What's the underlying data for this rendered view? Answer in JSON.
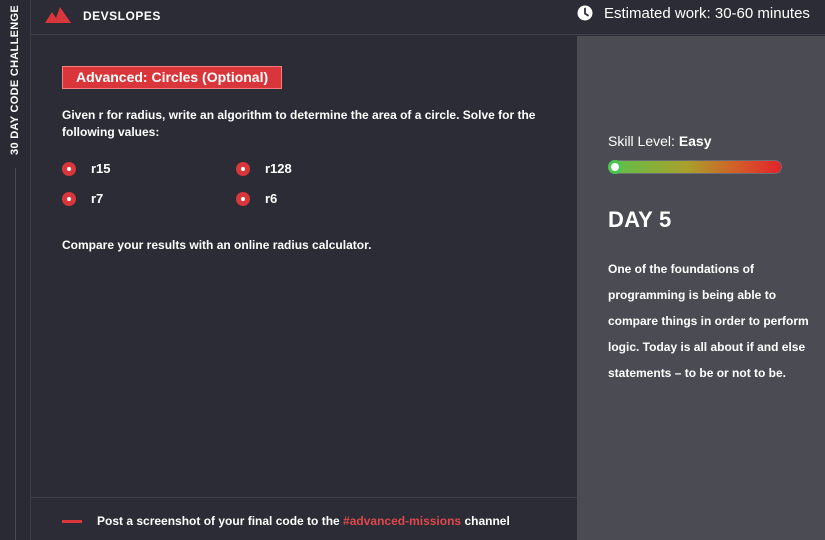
{
  "side_strip": {
    "label": "30 DAY CODE CHALLENGE"
  },
  "header": {
    "brand": "DEVSLOPES",
    "estimate": "Estimated work: 30-60 minutes",
    "icons": {
      "logo": "devslopes-logo-icon",
      "clock": "clock-icon"
    }
  },
  "mission": {
    "badge": "Advanced: Circles (Optional)",
    "description": "Given r for radius, write an algorithm to determine the area of a circle. Solve for the following values:",
    "values": [
      "r15",
      "r128",
      "r7",
      "r6"
    ],
    "compare": "Compare your results with an online radius calculator.",
    "footer": {
      "prefix": "Post a screenshot of your final code to the ",
      "channel": "#advanced-missions",
      "suffix": " channel"
    }
  },
  "sidebar": {
    "skill_label": "Skill Level: ",
    "skill_value": "Easy",
    "skill_level_fraction": 0.0,
    "day": "DAY 5",
    "paragraph": "One of the foundations of programming is being able to compare things in order to perform logic. Today is all about if and else statements – to be or not to be."
  },
  "colors": {
    "accent": "#d9363b",
    "background": "#2b2c35",
    "side_panel": "#4a4b53",
    "easy_green": "#4ac64f"
  }
}
